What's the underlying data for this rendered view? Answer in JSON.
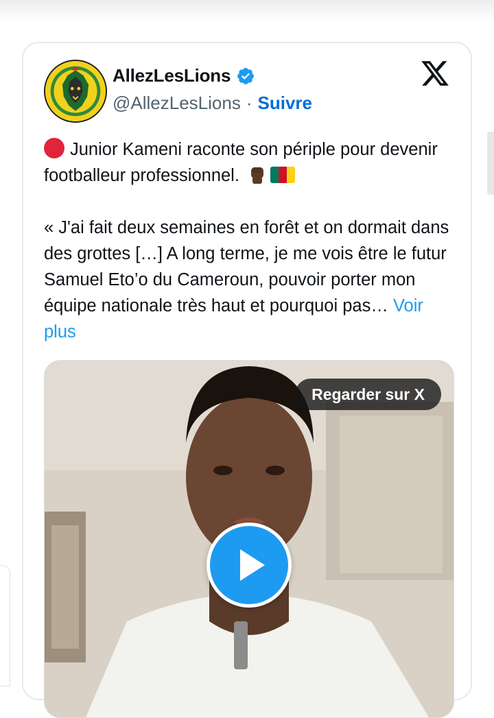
{
  "account": {
    "name": "AllezLesLions",
    "handle": "@AllezLesLions",
    "separator": "·",
    "follow_label": "Suivre"
  },
  "tweet": {
    "line1": "Junior Kameni raconte son périple pour devenir footballeur professionnel.",
    "quote": "« J'ai fait deux semaines en forêt et on dormait dans des grottes […] A long terme, je me vois être le futur Samuel Eto’o du Cameroun, pouvoir porter mon équipe nationale très haut et pourquoi pas…",
    "see_more": "Voir plus"
  },
  "media": {
    "watch_label": "Regarder sur X"
  },
  "icons": {
    "verified": "verified-badge-icon",
    "platform": "x-logo-icon",
    "play": "play-icon"
  },
  "colors": {
    "link": "#1d9bf0",
    "follow": "#006fd6",
    "verified": "#1d9bf0",
    "avatar_bg": "#f1d11c"
  }
}
